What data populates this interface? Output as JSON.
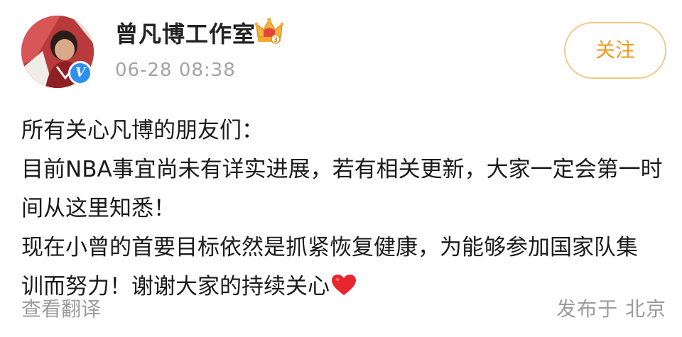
{
  "header": {
    "username": "曾凡博工作室",
    "timestamp": "06-28 08:38",
    "follow_label": "关注",
    "verified_mark": "V"
  },
  "post": {
    "lines": [
      "所有关心凡博的朋友们：",
      "目前NBA事宜尚未有详实进展，若有相关更新，大家一定会第一时",
      "间从这里知悉！",
      "现在小曾的首要目标依然是抓紧恢复健康，为能够参加国家队集",
      "训而努力！谢谢大家的持续关心"
    ],
    "trailing_emoji": "red-heart-icon"
  },
  "footer": {
    "translate_label": "查看翻译",
    "location_label": "发布于 北京"
  },
  "colors": {
    "follow_text": "#ef9a1c",
    "follow_border": "#f1c98a",
    "verified_blue": "#2e8ff0",
    "muted_text": "#9c9c9c",
    "heart_red": "#e8262f"
  }
}
